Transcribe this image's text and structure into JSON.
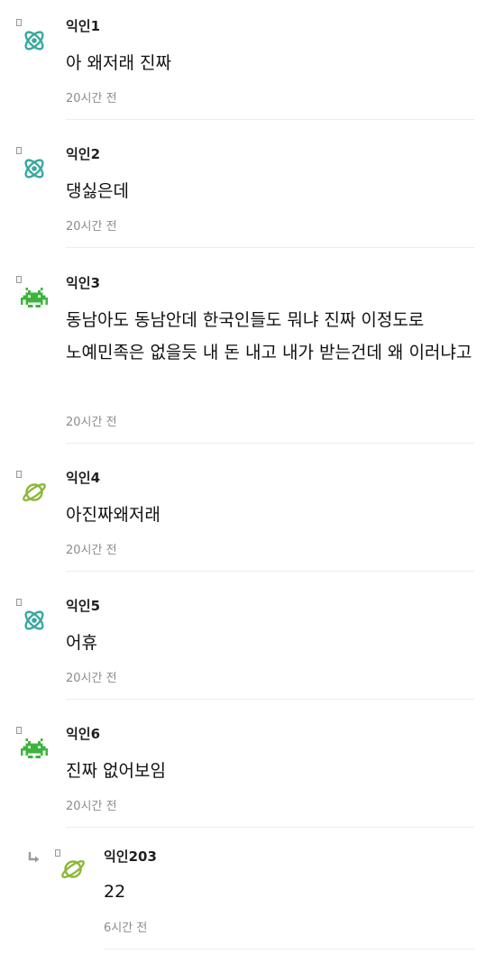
{
  "comments": [
    {
      "author": "익인1",
      "body": "아 왜저래 진짜",
      "time": "20시간 전",
      "avatar": "atom-icon"
    },
    {
      "author": "익인2",
      "body": "댕싫은데",
      "time": "20시간 전",
      "avatar": "atom-icon"
    },
    {
      "author": "익인3",
      "body": "동남아도 동남안데 한국인들도 뭐냐 진짜 이정도로 노예민족은 없을듯 내 돈 내고 내가 받는건데 왜 이러냐고",
      "time": "20시간 전",
      "avatar": "space-invader-icon"
    },
    {
      "author": "익인4",
      "body": "아진짜왜저래",
      "time": "20시간 전",
      "avatar": "planet-icon"
    },
    {
      "author": "익인5",
      "body": "어휴",
      "time": "20시간 전",
      "avatar": "atom-icon"
    },
    {
      "author": "익인6",
      "body": "진짜 없어보임",
      "time": "20시간 전",
      "avatar": "space-invader-icon"
    }
  ],
  "reply": {
    "author": "익인203",
    "body": "22",
    "time": "6시간 전",
    "avatar": "planet-icon"
  },
  "colors": {
    "atom": "#3aa8a0",
    "invader": "#3cb43c",
    "planet": "#8cb83a",
    "time_text": "#8c8c8c",
    "divider": "#ececec"
  }
}
